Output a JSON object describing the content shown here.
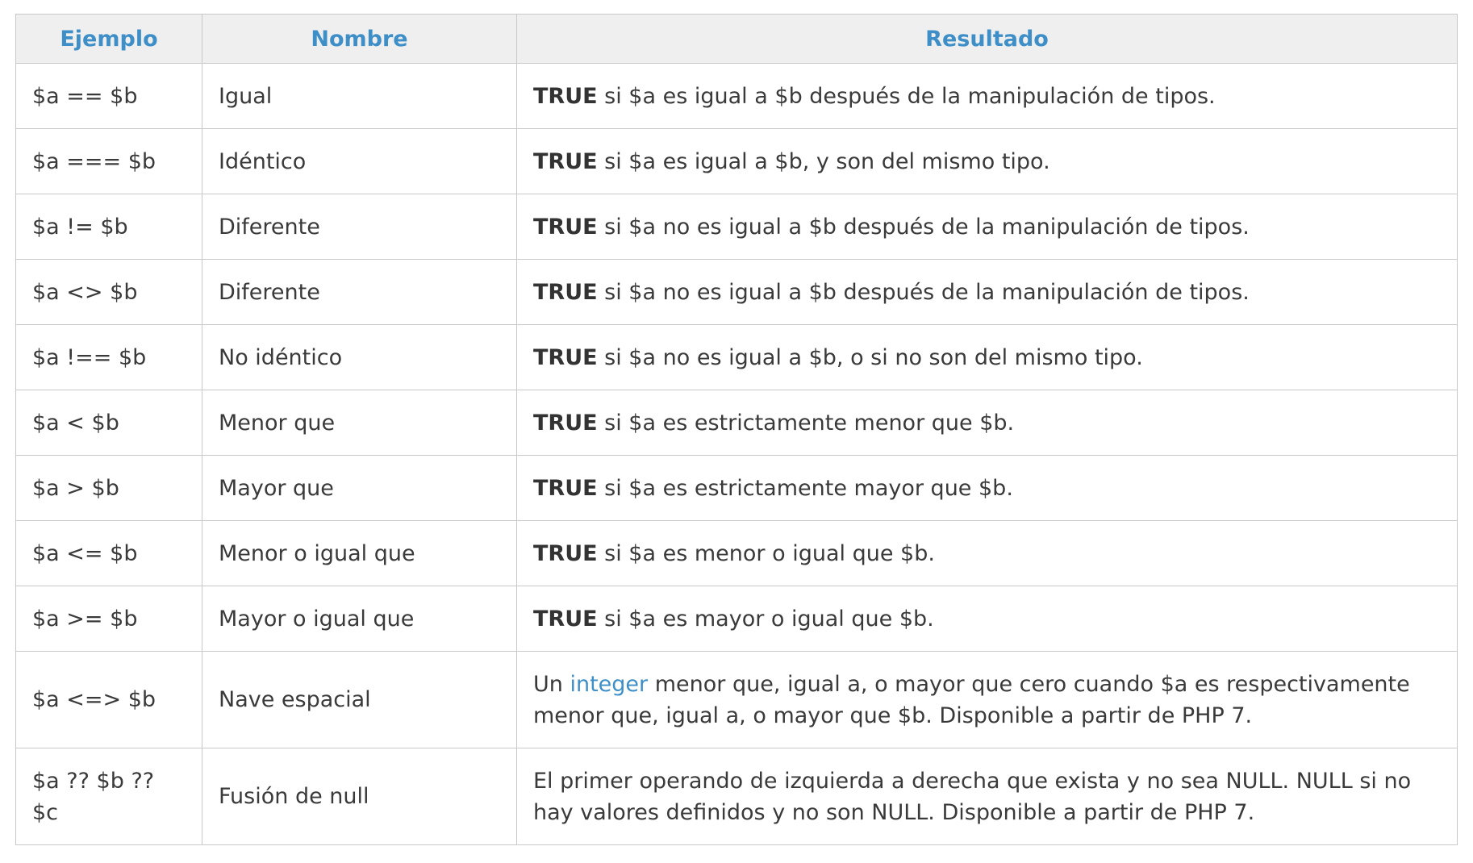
{
  "table": {
    "headers": {
      "example": "Ejemplo",
      "name": "Nombre",
      "result": "Resultado"
    },
    "keyword": "TRUE",
    "rows": [
      {
        "example": "$a == $b",
        "name": "Igual",
        "result": " si $a es igual a $b después de la manipulación de tipos."
      },
      {
        "example": "$a === $b",
        "name": "Idéntico",
        "result": " si $a es igual a $b, y son del mismo tipo."
      },
      {
        "example": "$a != $b",
        "name": "Diferente",
        "result": " si $a no es igual a $b después de la manipulación de tipos."
      },
      {
        "example": "$a <> $b",
        "name": "Diferente",
        "result": " si $a no es igual a $b después de la manipulación de tipos."
      },
      {
        "example": "$a !== $b",
        "name": "No idéntico",
        "result": " si $a no es igual a $b, o si no son del mismo tipo."
      },
      {
        "example": "$a < $b",
        "name": "Menor que",
        "result": " si $a es estrictamente menor que $b."
      },
      {
        "example": "$a > $b",
        "name": "Mayor que",
        "result": " si $a es estrictamente mayor que $b."
      },
      {
        "example": "$a <= $b",
        "name": "Menor o igual que",
        "result": " si $a es menor o igual que $b."
      },
      {
        "example": "$a >= $b",
        "name": "Mayor o igual que",
        "result": " si $a es mayor o igual que $b."
      }
    ],
    "spaceship": {
      "example": "$a <=> $b",
      "name": "Nave espacial",
      "result_prefix": "Un ",
      "result_link": "integer",
      "result_suffix": " menor que, igual a, o mayor que cero cuando $a es respectivamente menor que, igual a, o mayor que $b. Disponible a partir de PHP 7."
    },
    "null_coalesce": {
      "example": "$a ?? $b ?? $c",
      "name": "Fusión de null",
      "result": "El primer operando de izquierda a derecha que exista y no sea NULL. NULL si no hay valores definidos y no son NULL. Disponible a partir de PHP 7."
    }
  }
}
